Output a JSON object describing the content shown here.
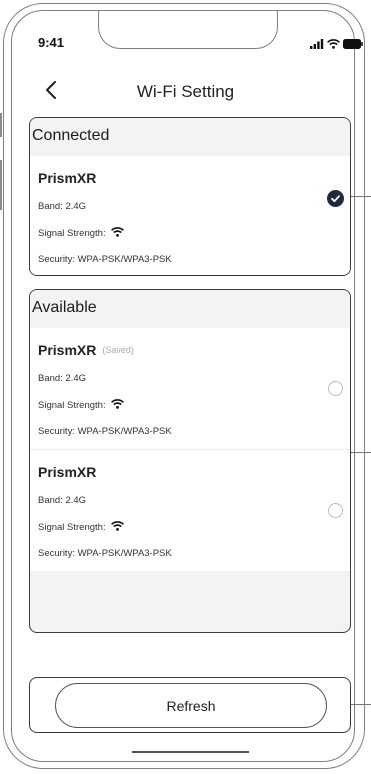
{
  "status_bar": {
    "time": "9:41"
  },
  "header": {
    "title": "Wi-Fi Setting"
  },
  "connected": {
    "section_title": "Connected",
    "network": {
      "name": "PrismXR",
      "band": "Band: 2.4G",
      "signal_label": "Signal Strength:",
      "security": "Security: WPA-PSK/WPA3-PSK",
      "selected": true
    }
  },
  "available": {
    "section_title": "Available",
    "networks": [
      {
        "name": "PrismXR",
        "tag": "(Saved)",
        "band": "Band: 2.4G",
        "signal_label": "Signal Strength:",
        "security": "Security: WPA-PSK/WPA3-PSK",
        "selected": false
      },
      {
        "name": "PrismXR",
        "band": "Band: 2.4G",
        "signal_label": "Signal Strength:",
        "security": "Security: WPA-PSK/WPA3-PSK",
        "selected": false
      }
    ]
  },
  "footer": {
    "refresh_label": "Refresh"
  },
  "colors": {
    "selected_check": "#1e2a3e",
    "section_bg": "#f3f3f3",
    "frame_border": "#3a3a3a"
  },
  "icons": {
    "back": "chevron-left-icon",
    "wifi": "wifi-icon",
    "check": "checkmark-icon",
    "signal": "cellular-signal-icon",
    "battery": "battery-icon"
  }
}
